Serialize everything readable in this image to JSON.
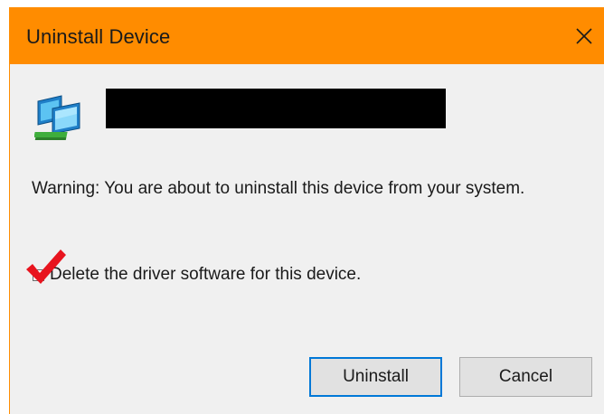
{
  "window": {
    "title": "Uninstall Device",
    "title_bar_color": "#ff8c00",
    "close_icon": "close-icon"
  },
  "device": {
    "icon": "network-adapter-icon",
    "name_redacted": true
  },
  "message": {
    "warning": "Warning: You are about to uninstall this device from your system."
  },
  "options": {
    "delete_driver_label": "Delete the driver software for this device.",
    "delete_driver_checked": false,
    "annotation": "red-checkmark-icon"
  },
  "buttons": {
    "uninstall_label": "Uninstall",
    "cancel_label": "Cancel"
  },
  "colors": {
    "accent": "#0078d7",
    "annotation": "#e8141e"
  }
}
